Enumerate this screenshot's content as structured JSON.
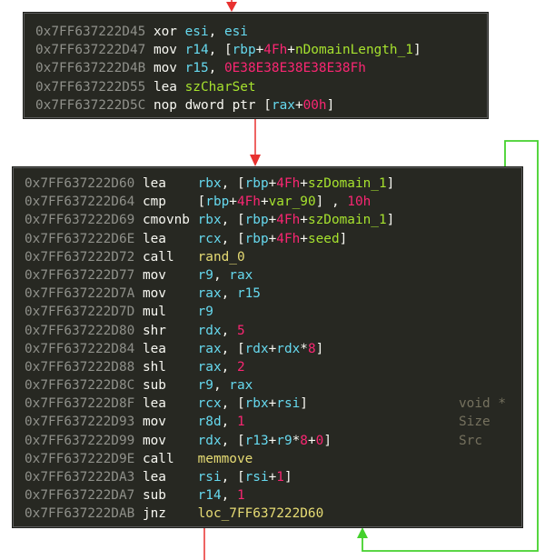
{
  "blocks": [
    {
      "id": "prologue",
      "lines": [
        {
          "addr": "0x7FF637222D45",
          "mn": "xor",
          "ops": [
            [
              "reg",
              "esi"
            ],
            [
              "pl",
              ", "
            ],
            [
              "reg",
              "esi"
            ]
          ]
        },
        {
          "addr": "0x7FF637222D47",
          "mn": "mov",
          "ops": [
            [
              "reg",
              "r14"
            ],
            [
              "pl",
              ", ["
            ],
            [
              "reg",
              "rbp"
            ],
            [
              "pl",
              "+"
            ],
            [
              "num",
              "4Fh"
            ],
            [
              "pl",
              "+"
            ],
            [
              "var",
              "nDomainLength_1"
            ],
            [
              "pl",
              "]"
            ]
          ]
        },
        {
          "addr": "0x7FF637222D4B",
          "mn": "mov",
          "ops": [
            [
              "reg",
              "r15"
            ],
            [
              "pl",
              ", "
            ],
            [
              "num",
              "0E38E38E38E38E38Fh"
            ]
          ]
        },
        {
          "addr": "0x7FF637222D55",
          "mn": "lea",
          "ops": [
            [
              "var",
              "szCharSet"
            ]
          ]
        },
        {
          "addr": "0x7FF637222D5C",
          "mn": "nop",
          "ops": [
            [
              "pl",
              "dword ptr ["
            ],
            [
              "reg",
              "rax"
            ],
            [
              "pl",
              "+"
            ],
            [
              "num",
              "00h"
            ],
            [
              "pl",
              "]"
            ]
          ]
        }
      ]
    },
    {
      "id": "loop",
      "lines": [
        {
          "addr": "0x7FF637222D60",
          "mn": "lea",
          "ops": [
            [
              "reg",
              "rbx"
            ],
            [
              "pl",
              ", ["
            ],
            [
              "reg",
              "rbp"
            ],
            [
              "pl",
              "+"
            ],
            [
              "num",
              "4Fh"
            ],
            [
              "pl",
              "+"
            ],
            [
              "var",
              "szDomain_1"
            ],
            [
              "pl",
              "]"
            ]
          ]
        },
        {
          "addr": "0x7FF637222D64",
          "mn": "cmp",
          "ops": [
            [
              "pl",
              "["
            ],
            [
              "reg",
              "rbp"
            ],
            [
              "pl",
              "+"
            ],
            [
              "num",
              "4Fh"
            ],
            [
              "pl",
              "+"
            ],
            [
              "var",
              "var_90"
            ],
            [
              "pl",
              "] , "
            ],
            [
              "num",
              "10h"
            ]
          ]
        },
        {
          "addr": "0x7FF637222D69",
          "mn": "cmovnb",
          "ops": [
            [
              "reg",
              "rbx"
            ],
            [
              "pl",
              ", ["
            ],
            [
              "reg",
              "rbp"
            ],
            [
              "pl",
              "+"
            ],
            [
              "num",
              "4Fh"
            ],
            [
              "pl",
              "+"
            ],
            [
              "var",
              "szDomain_1"
            ],
            [
              "pl",
              "]"
            ]
          ]
        },
        {
          "addr": "0x7FF637222D6E",
          "mn": "lea",
          "ops": [
            [
              "reg",
              "rcx"
            ],
            [
              "pl",
              ", ["
            ],
            [
              "reg",
              "rbp"
            ],
            [
              "pl",
              "+"
            ],
            [
              "num",
              "4Fh"
            ],
            [
              "pl",
              "+"
            ],
            [
              "var",
              "seed"
            ],
            [
              "pl",
              "]"
            ]
          ]
        },
        {
          "addr": "0x7FF637222D72",
          "mn": "call",
          "ops": [
            [
              "sym",
              "rand_0"
            ]
          ]
        },
        {
          "addr": "0x7FF637222D77",
          "mn": "mov",
          "ops": [
            [
              "reg",
              "r9"
            ],
            [
              "pl",
              ", "
            ],
            [
              "reg",
              "rax"
            ]
          ]
        },
        {
          "addr": "0x7FF637222D7A",
          "mn": "mov",
          "ops": [
            [
              "reg",
              "rax"
            ],
            [
              "pl",
              ", "
            ],
            [
              "reg",
              "r15"
            ]
          ]
        },
        {
          "addr": "0x7FF637222D7D",
          "mn": "mul",
          "ops": [
            [
              "reg",
              "r9"
            ]
          ]
        },
        {
          "addr": "0x7FF637222D80",
          "mn": "shr",
          "ops": [
            [
              "reg",
              "rdx"
            ],
            [
              "pl",
              ", "
            ],
            [
              "num",
              "5"
            ]
          ]
        },
        {
          "addr": "0x7FF637222D84",
          "mn": "lea",
          "ops": [
            [
              "reg",
              "rax"
            ],
            [
              "pl",
              ", ["
            ],
            [
              "reg",
              "rdx"
            ],
            [
              "pl",
              "+"
            ],
            [
              "reg",
              "rdx"
            ],
            [
              "pl",
              "*"
            ],
            [
              "num",
              "8"
            ],
            [
              "pl",
              "]"
            ]
          ]
        },
        {
          "addr": "0x7FF637222D88",
          "mn": "shl",
          "ops": [
            [
              "reg",
              "rax"
            ],
            [
              "pl",
              ", "
            ],
            [
              "num",
              "2"
            ]
          ]
        },
        {
          "addr": "0x7FF637222D8C",
          "mn": "sub",
          "ops": [
            [
              "reg",
              "r9"
            ],
            [
              "pl",
              ", "
            ],
            [
              "reg",
              "rax"
            ]
          ]
        },
        {
          "addr": "0x7FF637222D8F",
          "mn": "lea",
          "ops": [
            [
              "reg",
              "rcx"
            ],
            [
              "pl",
              ", ["
            ],
            [
              "reg",
              "rbx"
            ],
            [
              "pl",
              "+"
            ],
            [
              "reg",
              "rsi"
            ],
            [
              "pl",
              "]"
            ]
          ]
        },
        {
          "addr": "0x7FF637222D93",
          "mn": "mov",
          "ops": [
            [
              "reg",
              "r8d"
            ],
            [
              "pl",
              ", "
            ],
            [
              "num",
              "1"
            ]
          ]
        },
        {
          "addr": "0x7FF637222D99",
          "mn": "mov",
          "ops": [
            [
              "reg",
              "rdx"
            ],
            [
              "pl",
              ", ["
            ],
            [
              "reg",
              "r13"
            ],
            [
              "pl",
              "+"
            ],
            [
              "reg",
              "r9"
            ],
            [
              "pl",
              "*"
            ],
            [
              "num",
              "8"
            ],
            [
              "pl",
              "+"
            ],
            [
              "num",
              "0"
            ],
            [
              "pl",
              "]"
            ]
          ]
        },
        {
          "addr": "0x7FF637222D9E",
          "mn": "call",
          "ops": [
            [
              "sym",
              "memmove"
            ]
          ]
        },
        {
          "addr": "0x7FF637222DA3",
          "mn": "lea",
          "ops": [
            [
              "reg",
              "rsi"
            ],
            [
              "pl",
              ", ["
            ],
            [
              "reg",
              "rsi"
            ],
            [
              "pl",
              "+"
            ],
            [
              "num",
              "1"
            ],
            [
              "pl",
              "]"
            ]
          ]
        },
        {
          "addr": "0x7FF637222DA7",
          "mn": "sub",
          "ops": [
            [
              "reg",
              "r14"
            ],
            [
              "pl",
              ", "
            ],
            [
              "num",
              "1"
            ]
          ]
        },
        {
          "addr": "0x7FF637222DAB",
          "mn": "jnz",
          "ops": [
            [
              "sym",
              "loc_7FF637222D60"
            ]
          ]
        }
      ],
      "comments": [
        "void *",
        "Size",
        "Src"
      ]
    }
  ],
  "colors": {
    "background": "#272822",
    "address": "#8f908a",
    "mnemonic": "#f8f8f2",
    "register": "#66d9ef",
    "number": "#f92672",
    "variable": "#a6e22e",
    "symbol": "#e6db74",
    "comment": "#75715e",
    "edge_fallthrough": "#e8312f",
    "edge_loop_back": "#44d12c"
  }
}
